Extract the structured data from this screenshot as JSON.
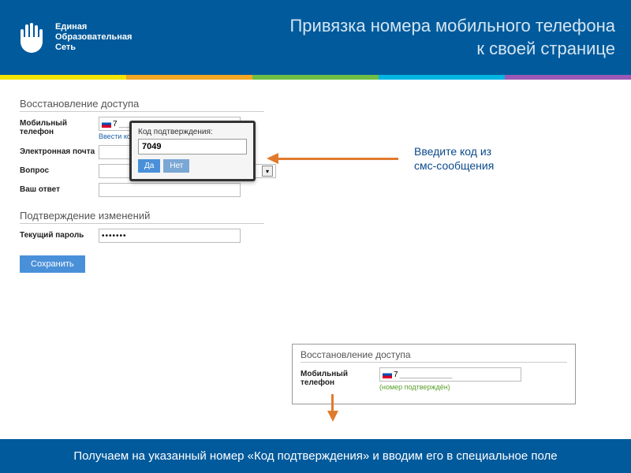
{
  "header": {
    "brand_line1": "Единая",
    "brand_line2": "Образовательная",
    "brand_line3": "Сеть",
    "title_line1": "Привязка номера мобильного телефона",
    "title_line2": "к своей странице"
  },
  "strip_colors": [
    "#f2e400",
    "#f5a623",
    "#6fbf44",
    "#00b5e2",
    "#9b59b6"
  ],
  "form": {
    "section1_title": "Восстановление доступа",
    "phone_label": "Мобильный телефон",
    "phone_prefix": "7",
    "phone_mask": "____________",
    "phone_link": "Ввести код подтверждения",
    "email_label": "Электронная почта",
    "email_value": "",
    "question_label": "Вопрос",
    "answer_label": "Ваш ответ",
    "section2_title": "Подтверждение изменений",
    "password_label": "Текущий пароль",
    "password_value": "•••••••",
    "save_btn": "Сохранить"
  },
  "popup": {
    "label": "Код подтверждения:",
    "value": "7049",
    "yes": "Да",
    "no": "Нет"
  },
  "annotation": {
    "text_line1": "Введите код из",
    "text_line2": "смс-сообщения"
  },
  "inset": {
    "title": "Восстановление доступа",
    "phone_label": "Мобильный телефон",
    "phone_prefix": "7",
    "phone_mask": "____________",
    "confirmed": "(номер подтверждён)"
  },
  "footer": {
    "text": "Получаем на указанный номер «Код подтверждения» и вводим его в специальное поле"
  }
}
